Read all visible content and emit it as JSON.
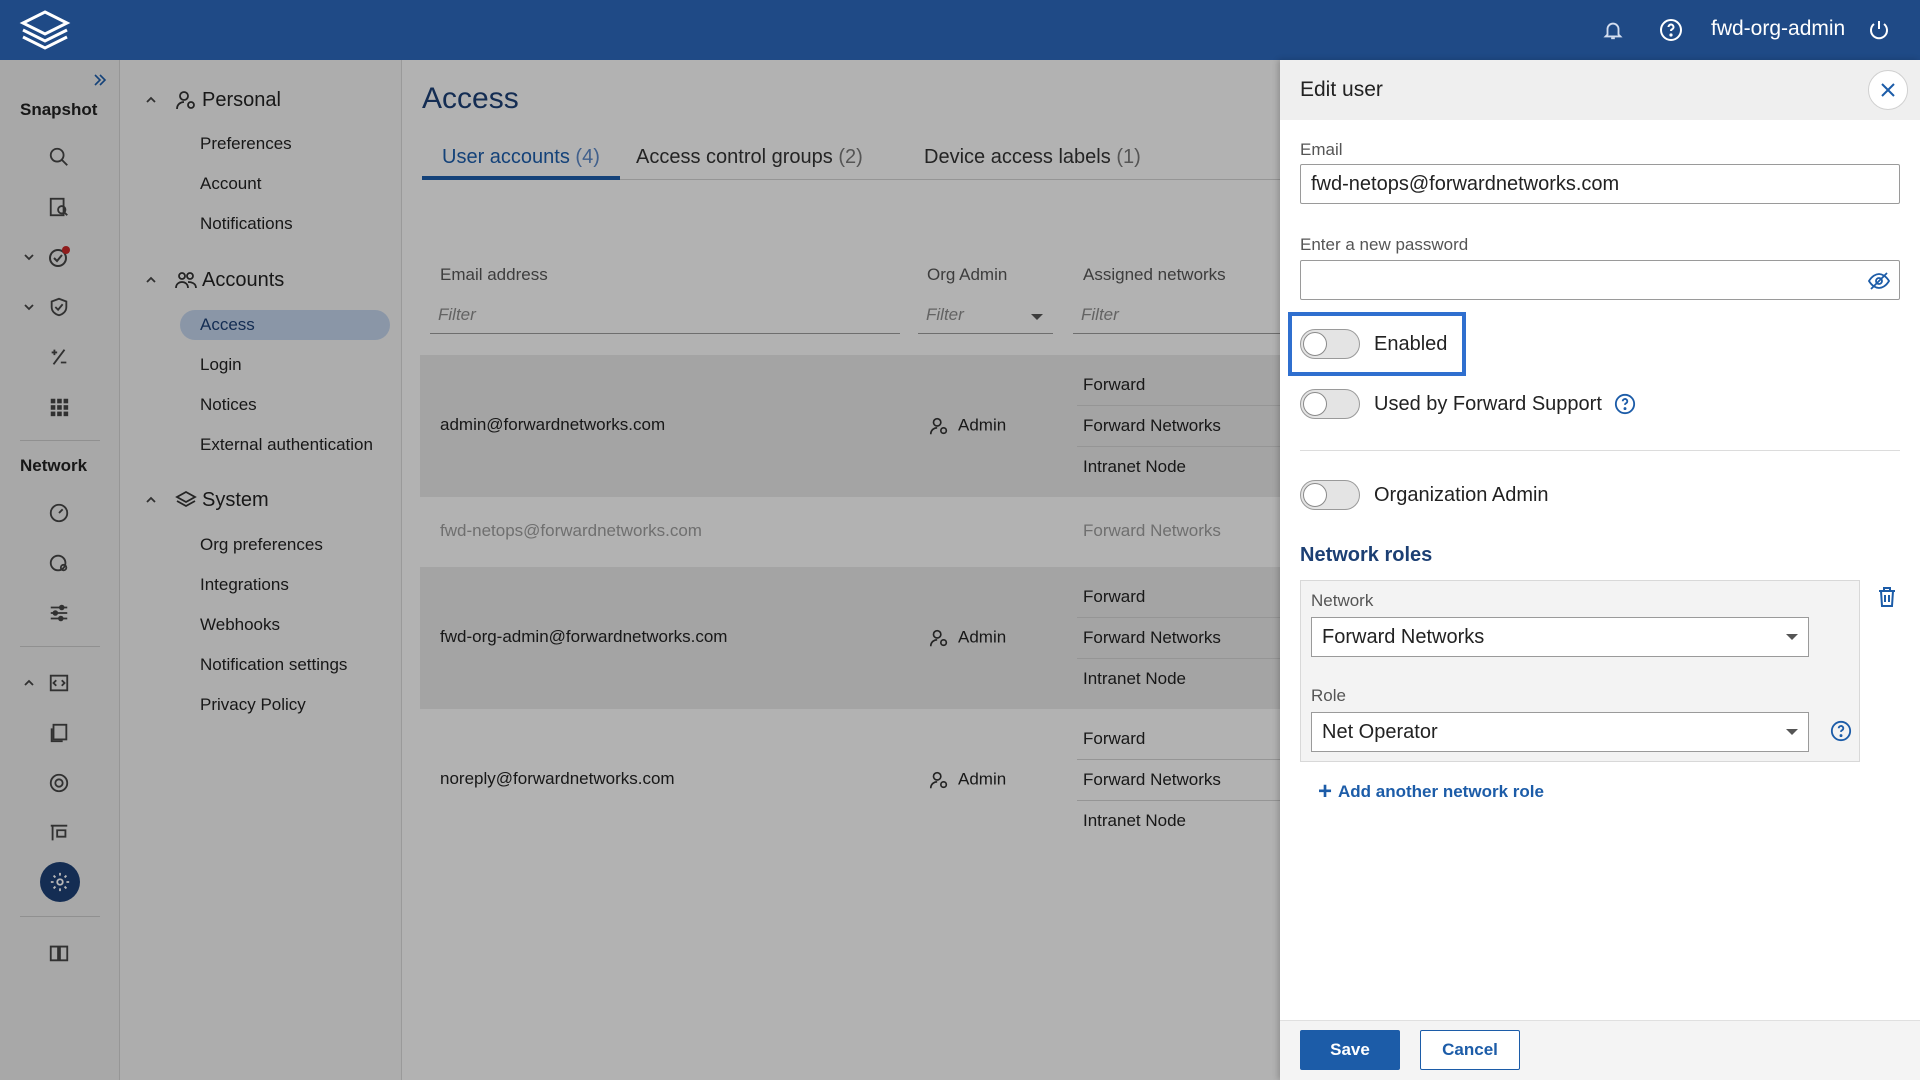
{
  "topbar": {
    "logo_icon": "forward-logo-icon",
    "user": "fwd-org-admin"
  },
  "rail": {
    "snapshot_label": "Snapshot",
    "network_label": "Network"
  },
  "settings_nav": {
    "personal": {
      "title": "Personal",
      "items": [
        "Preferences",
        "Account",
        "Notifications"
      ]
    },
    "accounts": {
      "title": "Accounts",
      "items": [
        "Access",
        "Login",
        "Notices",
        "External authentication"
      ],
      "active": "Access"
    },
    "system": {
      "title": "System",
      "items": [
        "Org preferences",
        "Integrations",
        "Webhooks",
        "Notification settings",
        "Privacy Policy"
      ]
    }
  },
  "main": {
    "title": "Access",
    "tabs": [
      {
        "label": "User accounts",
        "count": "(4)"
      },
      {
        "label": "Access control groups",
        "count": "(2)"
      },
      {
        "label": "Device access labels",
        "count": "(1)"
      }
    ],
    "columns": {
      "email": "Email address",
      "org_admin": "Org Admin",
      "networks": "Assigned networks"
    },
    "filter_placeholder": "Filter",
    "rows": [
      {
        "email": "admin@forwardnetworks.com",
        "admin": "Admin",
        "networks": [
          "Forward",
          "Forward Networks",
          "Intranet Node"
        ]
      },
      {
        "email": "fwd-netops@forwardnetworks.com",
        "admin": "",
        "networks": [
          "Forward Networks"
        ]
      },
      {
        "email": "fwd-org-admin@forwardnetworks.com",
        "admin": "Admin",
        "networks": [
          "Forward",
          "Forward Networks",
          "Intranet Node"
        ]
      },
      {
        "email": "noreply@forwardnetworks.com",
        "admin": "Admin",
        "networks": [
          "Forward",
          "Forward Networks",
          "Intranet Node"
        ]
      }
    ]
  },
  "edit_panel": {
    "title": "Edit user",
    "email_label": "Email",
    "email_value": "fwd-netops@forwardnetworks.com",
    "password_label": "Enter a new password",
    "password_value": "",
    "enabled_label": "Enabled",
    "support_label": "Used by Forward Support",
    "org_admin_label": "Organization Admin",
    "network_roles_title": "Network roles",
    "network_label": "Network",
    "network_value": "Forward Networks",
    "role_label": "Role",
    "role_value": "Net Operator",
    "add_role_label": "Add another network role",
    "save_label": "Save",
    "cancel_label": "Cancel"
  },
  "colors": {
    "topbar": "#1f4a86",
    "accent": "#1c5ca8",
    "highlight_border": "#2f6fcf"
  }
}
